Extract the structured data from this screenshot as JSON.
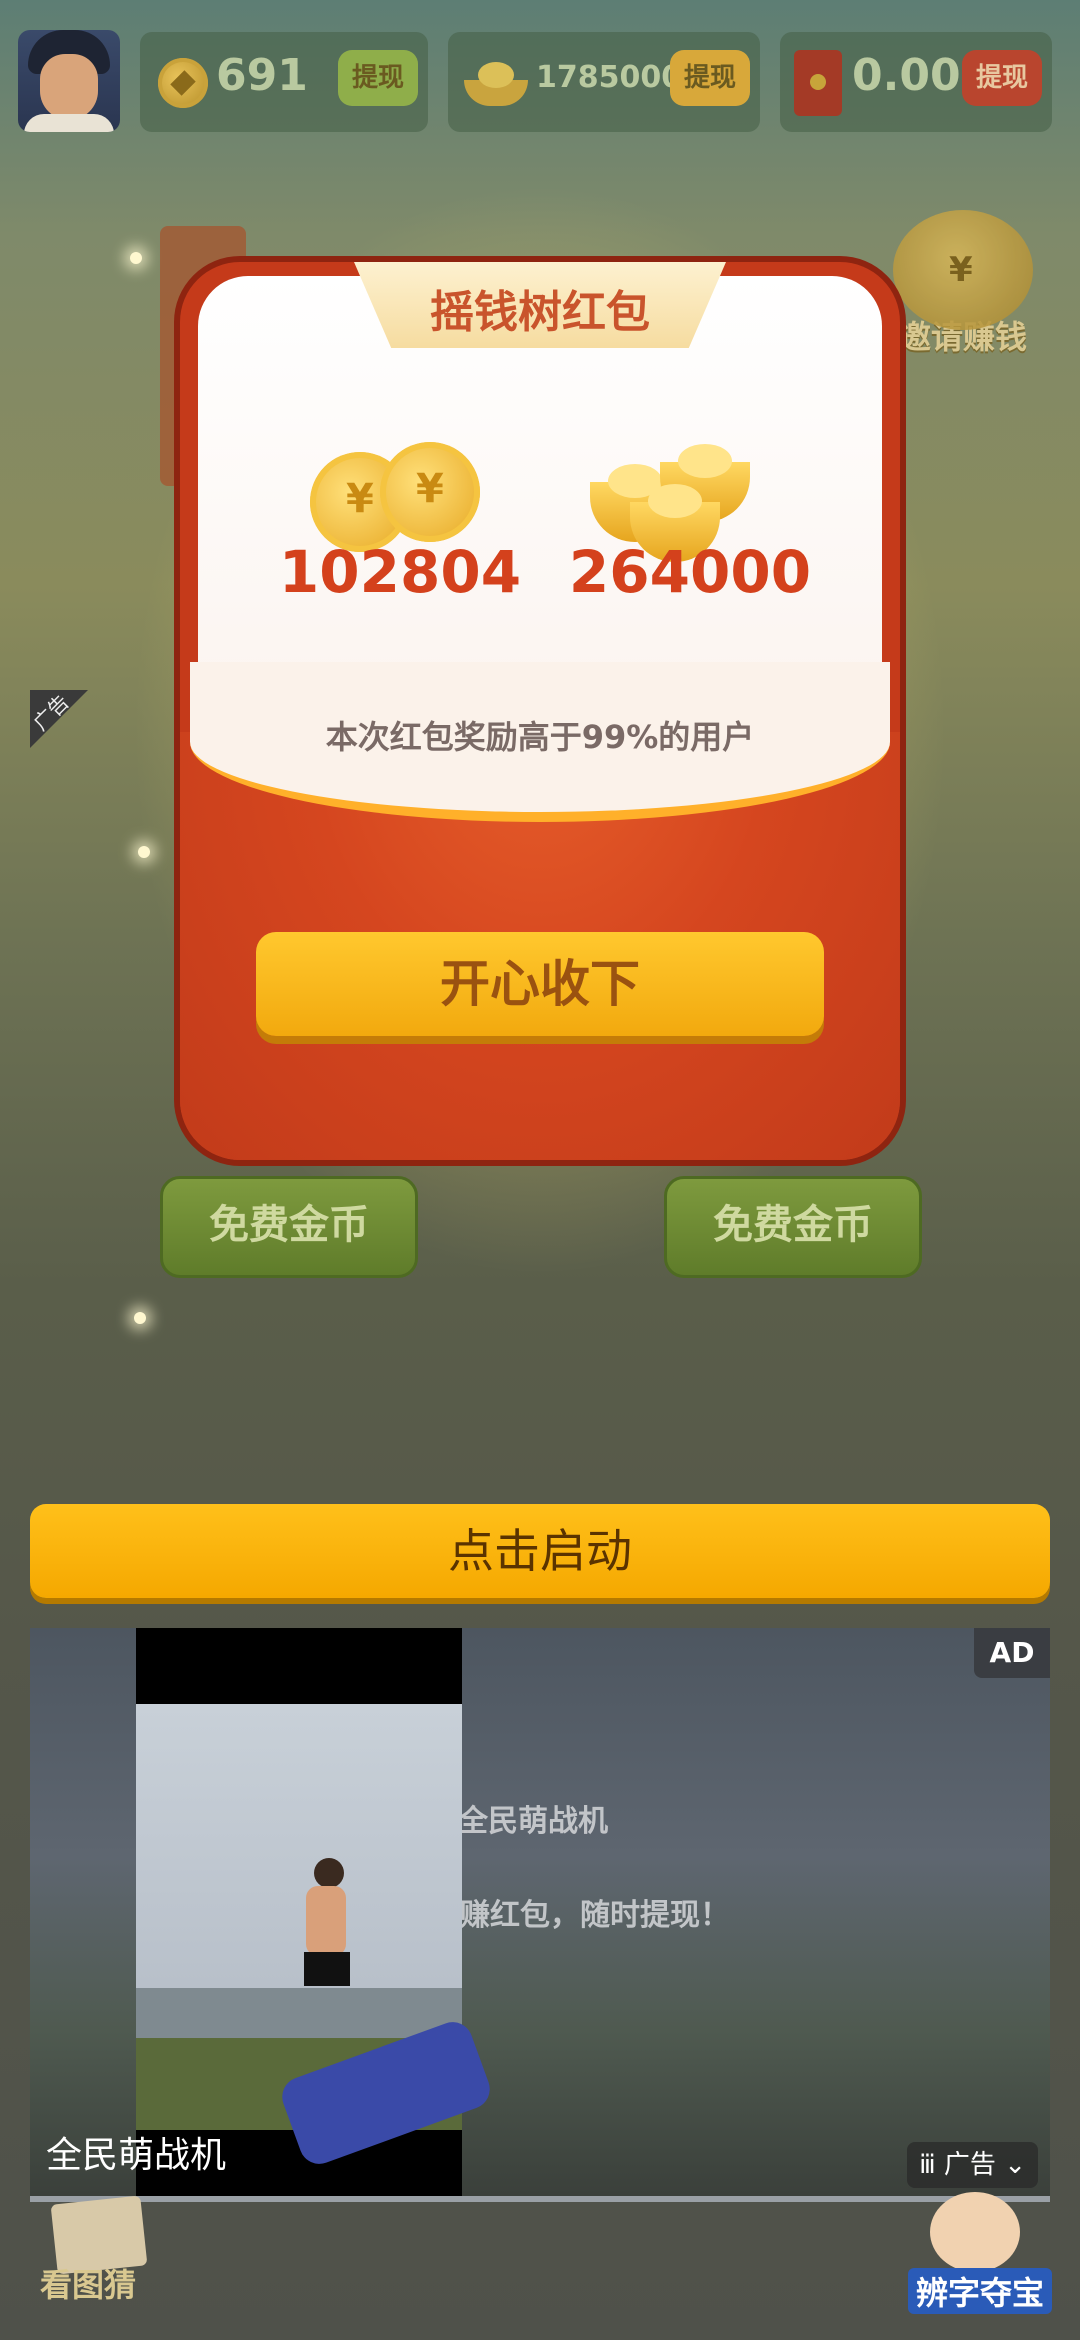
{
  "top_bar": {
    "gold_coins": {
      "value": "691",
      "withdraw_label": "提现"
    },
    "gold_ingots": {
      "value": "1785000",
      "withdraw_label": "提现"
    },
    "red_packet": {
      "value": "0.00",
      "withdraw_label": "提现"
    }
  },
  "background": {
    "invite_label": "邀请赚钱",
    "ad_corner_label": "广告",
    "free_coin_buttons": [
      "免费金币",
      "免费金币"
    ],
    "bottom_left_label": "看图猜",
    "bottom_right_label": "辨字夺宝"
  },
  "modal": {
    "title": "摇钱树红包",
    "coin_reward": "102804",
    "ingot_reward": "264000",
    "note": "本次红包奖励高于99%的用户",
    "accept_label": "开心收下"
  },
  "cta": {
    "label": "点击启动"
  },
  "ad": {
    "badge": "AD",
    "app_name": "全民萌战机",
    "blur_title": "全民萌战机",
    "blur_slogan": "赚红包，随时提现！",
    "tag_label": "广告"
  },
  "colors": {
    "modal_red": "#c53a1a",
    "button_yellow": "#ffc01a",
    "reward_text": "#d4411c"
  }
}
